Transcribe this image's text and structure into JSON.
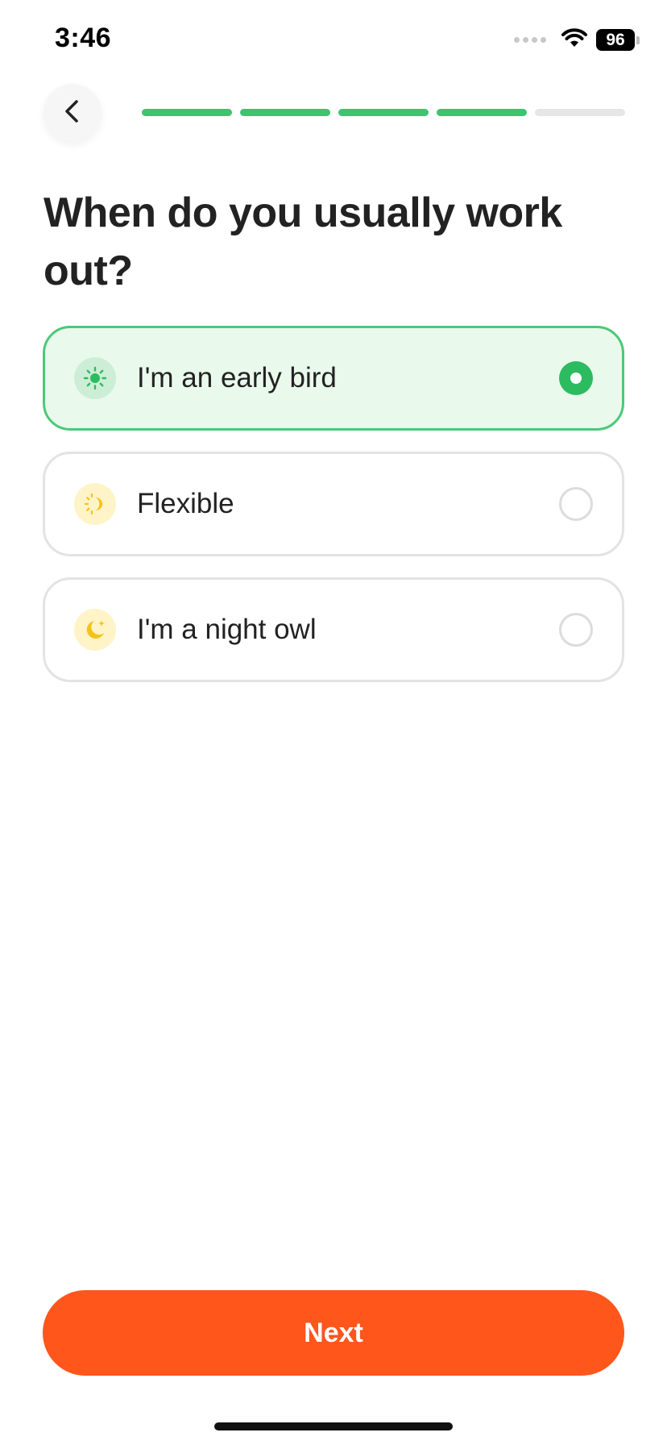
{
  "status_bar": {
    "time": "3:46",
    "battery": "96"
  },
  "header": {
    "progress": {
      "total_steps": 5,
      "completed_steps": 4
    }
  },
  "title": "When do you usually work out?",
  "options": [
    {
      "label": "I'm an early bird",
      "icon": "sun-icon",
      "selected": true
    },
    {
      "label": "Flexible",
      "icon": "sun-moon-icon",
      "selected": false
    },
    {
      "label": "I'm a night owl",
      "icon": "moon-star-icon",
      "selected": false
    }
  ],
  "next_button": {
    "label": "Next"
  },
  "colors": {
    "accent_green": "#3dc46e",
    "selected_bg": "#e9f9ec",
    "cta_orange": "#ff561c",
    "icon_yellow": "#f5c21b"
  }
}
